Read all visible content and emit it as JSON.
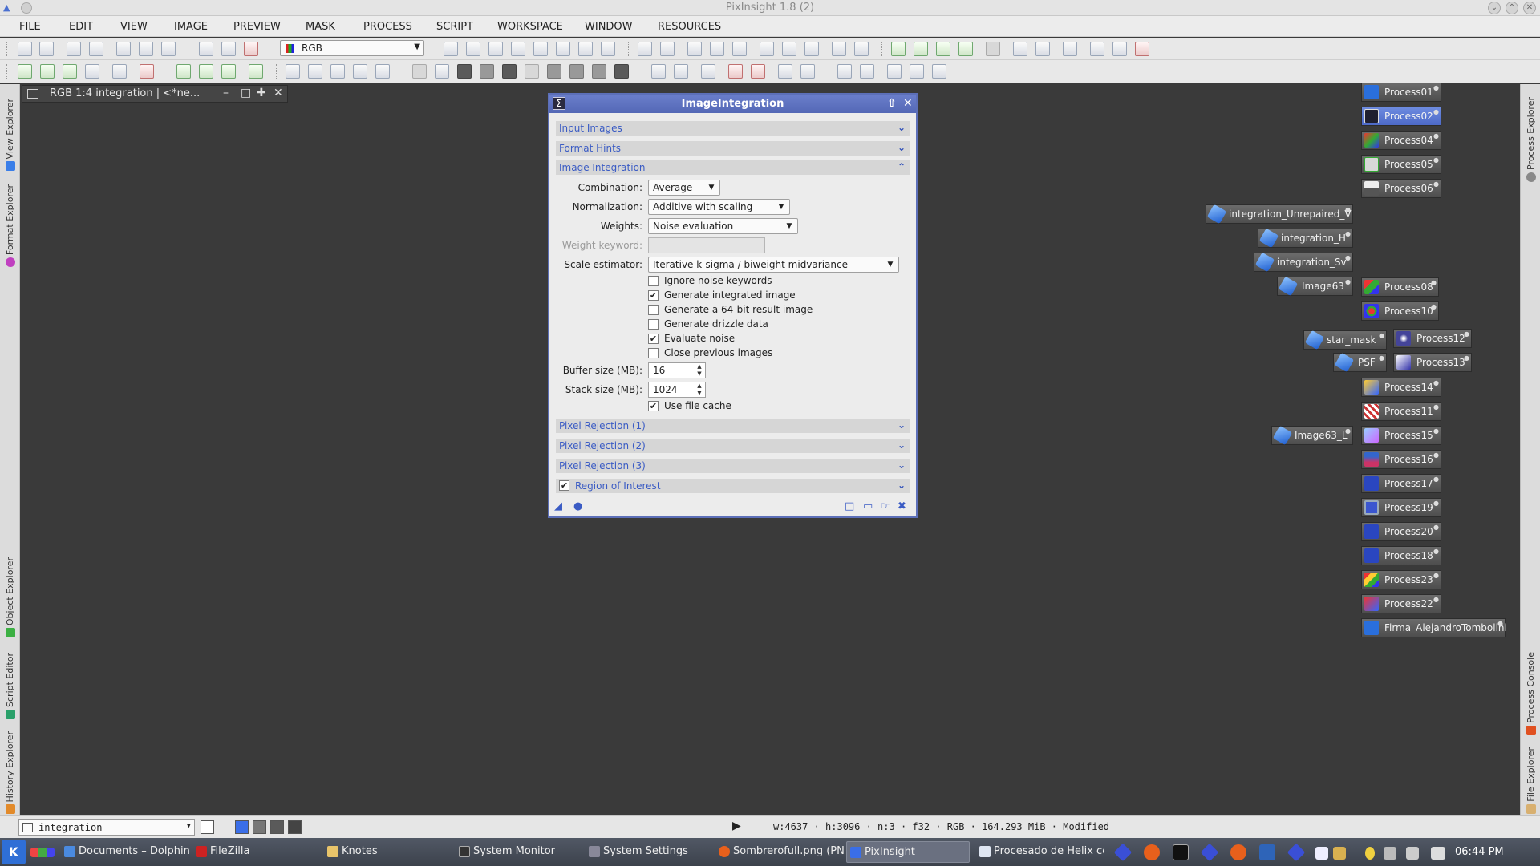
{
  "window": {
    "title": "PixInsight 1.8 (2)"
  },
  "menu": [
    "FILE",
    "EDIT",
    "VIEW",
    "IMAGE",
    "PREVIEW",
    "MASK",
    "PROCESS",
    "SCRIPT",
    "WORKSPACE",
    "WINDOW",
    "RESOURCES"
  ],
  "toolbar": {
    "channel_select": "RGB"
  },
  "image_window": {
    "title": "RGB 1:4 integration | <*ne..."
  },
  "left_dock": [
    "View Explorer",
    "Format Explorer",
    "Object Explorer",
    "Script Editor",
    "History Explorer"
  ],
  "right_dock": [
    "Process Explorer",
    "Process Console",
    "File Explorer"
  ],
  "dialog": {
    "title": "ImageIntegration",
    "sections": {
      "input_images": "Input Images",
      "format_hints": "Format Hints",
      "image_integration": "Image Integration",
      "pixel_rejection_1": "Pixel Rejection (1)",
      "pixel_rejection_2": "Pixel Rejection (2)",
      "pixel_rejection_3": "Pixel Rejection (3)",
      "region_of_interest": "Region of Interest"
    },
    "region_of_interest_checked": true,
    "fields": {
      "combination_label": "Combination:",
      "combination_value": "Average",
      "normalization_label": "Normalization:",
      "normalization_value": "Additive with scaling",
      "weights_label": "Weights:",
      "weights_value": "Noise evaluation",
      "weight_keyword_label": "Weight keyword:",
      "weight_keyword_value": "",
      "scale_estimator_label": "Scale estimator:",
      "scale_estimator_value": "Iterative k-sigma / biweight midvariance",
      "buffer_size_label": "Buffer size (MB):",
      "buffer_size_value": "16",
      "stack_size_label": "Stack size (MB):",
      "stack_size_value": "1024"
    },
    "checkboxes": [
      {
        "label": "Ignore noise keywords",
        "checked": false
      },
      {
        "label": "Generate integrated image",
        "checked": true
      },
      {
        "label": "Generate a 64-bit result image",
        "checked": false
      },
      {
        "label": "Generate drizzle data",
        "checked": false
      },
      {
        "label": "Evaluate noise",
        "checked": true
      },
      {
        "label": "Close previous images",
        "checked": false
      }
    ],
    "use_file_cache": {
      "label": "Use file cache",
      "checked": true
    }
  },
  "process_icons": [
    "Process01",
    "Process02",
    "Process04",
    "Process05",
    "Process06",
    "integration_Unrepaired_V",
    "integration_H",
    "integration_Sv",
    "Image63",
    "Process08",
    "Process10",
    "star_mask",
    "Process12",
    "PSF",
    "Process13",
    "Process14",
    "Process11",
    "Image63_L",
    "Process15",
    "Process16",
    "Process17",
    "Process19",
    "Process20",
    "Process18",
    "Process23",
    "Process22",
    "Firma_AlejandroTombolini"
  ],
  "statusbar": {
    "view_select": "integration",
    "info": "w:4637 · h:3096 · n:3 · f32 · RGB · 164.293 MiB · Modified"
  },
  "taskbar": {
    "start_label": "K",
    "tasks": [
      "Documents – Dolphin",
      "FileZilla",
      "Knotes",
      "System Monitor",
      "System Settings",
      "Sombrerofull.png (PN",
      "PixInsight",
      "Procesado de Helix co"
    ],
    "clock": "06:44 PM"
  },
  "colors": {
    "accent": "#5468b6",
    "workspace": "#3a3a3a",
    "section_text": "#3a5bc4"
  }
}
